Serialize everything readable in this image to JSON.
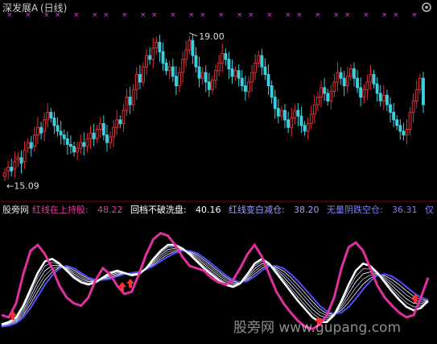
{
  "header": {
    "title": "深发展A",
    "period": "(日线)",
    "title_color": "#cfcfcf"
  },
  "overlay": {
    "settings_icon": "gear-icon"
  },
  "indicator_bar": [
    {
      "label": "股旁网",
      "value": "",
      "color": "#e0e0e0"
    },
    {
      "label": "红线在上持股:",
      "value": "48.22",
      "color": "#e040a0"
    },
    {
      "label": "回档不破洗盘:",
      "value": "40.16",
      "color": "#ffffff"
    },
    {
      "label": "红线变白减仓:",
      "value": "38.20",
      "color": "#9f9fff"
    },
    {
      "label": "无量阴跌空仓:",
      "value": "36.31",
      "color": "#7f7fff"
    },
    {
      "label": "仅",
      "value": "",
      "color": "#7f7fff"
    }
  ],
  "watermark": {
    "text": "股旁网 www.gupang.com"
  },
  "chart_data": [
    {
      "type": "candlestick",
      "title": "深发展A (日线)",
      "ylim": [
        14.8,
        19.4
      ],
      "annotations": [
        {
          "label": "19.00",
          "x": 56,
          "y": 19.0,
          "kind": "high"
        },
        {
          "label": "15.09",
          "x": 0,
          "y": 15.09,
          "kind": "low"
        }
      ],
      "x_marks_count": 26,
      "close": [
        15.3,
        15.45,
        15.35,
        15.6,
        15.7,
        15.55,
        15.9,
        16.1,
        15.95,
        16.3,
        16.5,
        16.35,
        16.7,
        16.9,
        16.75,
        16.55,
        16.4,
        16.3,
        16.2,
        16.05,
        16.0,
        15.85,
        15.95,
        16.1,
        16.0,
        16.2,
        16.35,
        16.2,
        16.45,
        16.6,
        16.3,
        16.1,
        16.25,
        16.5,
        16.7,
        16.6,
        16.95,
        17.3,
        17.1,
        17.5,
        17.9,
        17.7,
        18.1,
        18.4,
        18.3,
        18.6,
        18.75,
        18.5,
        18.2,
        18.0,
        18.1,
        17.85,
        17.6,
        17.95,
        18.3,
        18.55,
        18.8,
        18.4,
        18.1,
        17.8,
        17.95,
        17.7,
        17.5,
        17.75,
        18.0,
        18.2,
        18.45,
        18.3,
        18.05,
        17.85,
        18.0,
        17.8,
        17.6,
        17.45,
        17.7,
        17.95,
        18.2,
        18.4,
        18.1,
        17.9,
        17.6,
        17.3,
        17.0,
        16.8,
        16.95,
        16.7,
        16.5,
        16.75,
        16.95,
        16.8,
        16.55,
        16.4,
        16.6,
        16.85,
        17.1,
        17.3,
        17.55,
        17.4,
        17.2,
        17.45,
        17.7,
        17.95,
        17.8,
        17.6,
        17.85,
        18.05,
        17.8,
        17.55,
        17.3,
        17.5,
        17.7,
        17.9,
        17.65,
        17.4,
        17.2,
        17.35,
        17.1,
        16.9,
        16.7,
        16.55,
        16.4,
        16.3,
        16.45,
        16.9,
        17.2,
        17.5,
        17.8,
        17.1
      ],
      "open": [
        15.2,
        15.35,
        15.45,
        15.4,
        15.65,
        15.7,
        15.6,
        15.95,
        16.1,
        16.0,
        16.3,
        16.5,
        16.4,
        16.7,
        16.9,
        16.75,
        16.55,
        16.4,
        16.3,
        16.2,
        16.05,
        16.0,
        15.85,
        15.95,
        16.1,
        16.0,
        16.2,
        16.35,
        16.2,
        16.45,
        16.6,
        16.3,
        16.1,
        16.25,
        16.5,
        16.7,
        16.6,
        16.95,
        17.3,
        17.1,
        17.5,
        17.9,
        17.7,
        18.1,
        18.4,
        18.3,
        18.6,
        18.75,
        18.5,
        18.2,
        18.0,
        18.1,
        17.85,
        17.6,
        17.95,
        18.3,
        18.55,
        18.8,
        18.4,
        18.1,
        17.8,
        17.95,
        17.7,
        17.5,
        17.75,
        18.0,
        18.2,
        18.45,
        18.3,
        18.05,
        17.85,
        18.0,
        17.8,
        17.6,
        17.45,
        17.7,
        17.95,
        18.2,
        18.4,
        18.1,
        17.9,
        17.6,
        17.3,
        17.0,
        16.8,
        16.95,
        16.7,
        16.5,
        16.75,
        16.95,
        16.8,
        16.55,
        16.4,
        16.6,
        16.85,
        17.1,
        17.3,
        17.55,
        17.4,
        17.2,
        17.45,
        17.7,
        17.95,
        17.8,
        17.6,
        17.85,
        18.05,
        17.8,
        17.55,
        17.3,
        17.5,
        17.7,
        17.9,
        17.65,
        17.4,
        17.2,
        17.35,
        17.1,
        16.9,
        16.7,
        16.55,
        16.4,
        16.3,
        16.45,
        16.9,
        17.2,
        17.5,
        17.8
      ]
    },
    {
      "type": "line",
      "ylim": [
        0,
        100
      ],
      "series": [
        {
          "color": "#e030a0",
          "role": "red_line",
          "values": [
            20,
            18,
            30,
            55,
            75,
            80,
            72,
            60,
            45,
            35,
            30,
            28,
            35,
            50,
            60,
            55,
            45,
            38,
            40,
            55,
            72,
            85,
            90,
            88,
            80,
            70,
            62,
            60,
            58,
            52,
            48,
            46,
            50,
            60,
            72,
            80,
            70,
            55,
            40,
            30,
            22,
            15,
            10,
            8,
            12,
            20,
            35,
            60,
            78,
            82,
            75,
            60,
            45,
            35,
            28,
            22,
            18,
            20,
            35,
            52
          ]
        },
        {
          "color": "#ffffff",
          "role": "white_line",
          "values": [
            12,
            14,
            18,
            28,
            42,
            56,
            66,
            68,
            64,
            58,
            52,
            48,
            46,
            48,
            52,
            56,
            58,
            56,
            54,
            55,
            60,
            68,
            75,
            80,
            80,
            77,
            72,
            66,
            60,
            55,
            50,
            46,
            44,
            47,
            55,
            64,
            68,
            64,
            56,
            48,
            40,
            32,
            25,
            18,
            14,
            14,
            20,
            32,
            46,
            58,
            64,
            62,
            56,
            48,
            40,
            33,
            27,
            24,
            26,
            32
          ]
        },
        {
          "color": "#5050ff",
          "role": "blue_line",
          "values": [
            10,
            11,
            13,
            18,
            26,
            36,
            46,
            54,
            60,
            62,
            60,
            56,
            52,
            50,
            50,
            51,
            53,
            55,
            56,
            57,
            59,
            62,
            66,
            70,
            73,
            75,
            75,
            73,
            69,
            64,
            59,
            54,
            50,
            48,
            49,
            53,
            58,
            62,
            62,
            60,
            55,
            49,
            42,
            35,
            28,
            23,
            21,
            22,
            27,
            34,
            42,
            49,
            54,
            55,
            53,
            49,
            44,
            39,
            35,
            33
          ]
        },
        {
          "color": "#ffffff",
          "role": "band",
          "values": []
        }
      ],
      "signals_count": 5
    }
  ]
}
